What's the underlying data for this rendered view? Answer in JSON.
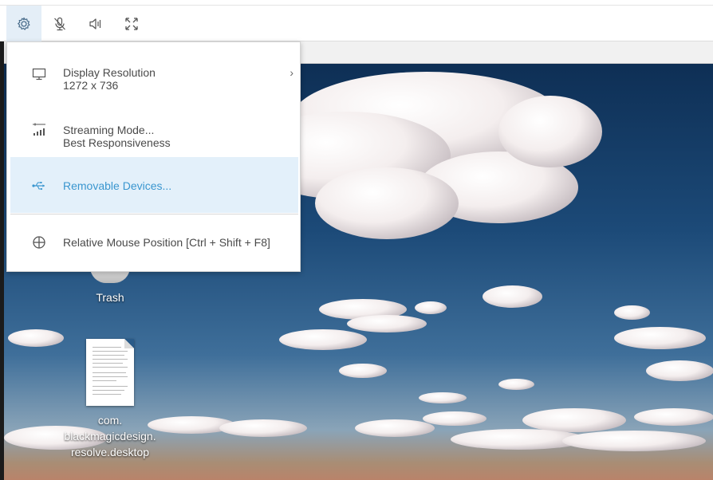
{
  "toolbar": {
    "buttons": [
      {
        "icon": "gear-icon",
        "active": true
      },
      {
        "icon": "microphone-muted-icon"
      },
      {
        "icon": "speaker-volume-icon"
      },
      {
        "icon": "fullscreen-icon"
      }
    ]
  },
  "menu": {
    "items": [
      {
        "label": "Display Resolution",
        "sublabel": "1272 x 736",
        "icon": "monitor-icon",
        "submenu": true
      },
      {
        "label": "Streaming Mode...",
        "sublabel": "Best Responsiveness",
        "icon": "signal-bars-icon"
      },
      {
        "label": "Removable Devices...",
        "icon": "usb-icon",
        "highlighted": true
      },
      {
        "label": "Relative Mouse Position [Ctrl + Shift + F8]",
        "icon": "crosshair-icon"
      }
    ]
  },
  "desktop": {
    "icons": [
      {
        "label": "Trash",
        "icon": "trash-icon"
      },
      {
        "label_lines": [
          "com.",
          "blackmagicdesign.",
          "resolve.desktop"
        ],
        "icon": "document-icon"
      }
    ]
  },
  "colors": {
    "accent": "#3a96cf",
    "selected_bg": "#e3f0fa",
    "active_tool_bg": "#e4eef7"
  }
}
